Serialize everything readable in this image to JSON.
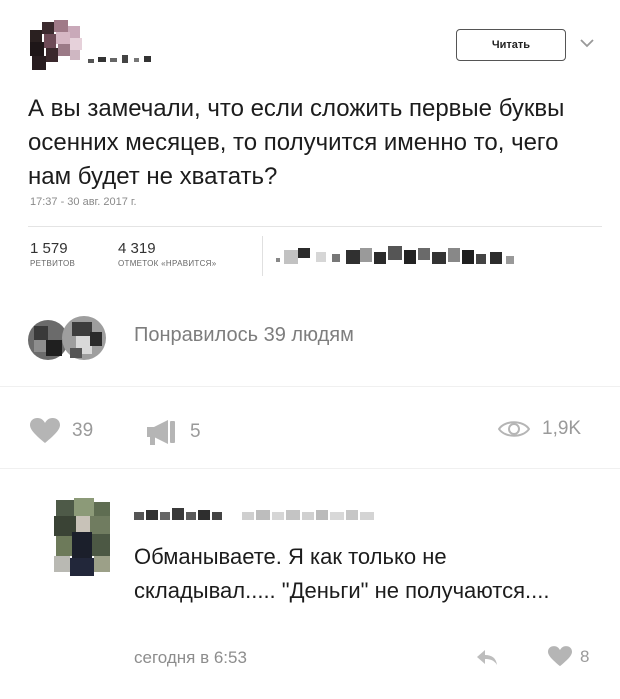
{
  "tweet": {
    "follow_label": "Читать",
    "text": "А вы замечали, что если сложить первые буквы осенних месяцев, то получится именно то, чего нам будет не хватать?",
    "timestamp": "17:37 - 30 авг. 2017 г.",
    "retweets": {
      "count": "1 579",
      "label": "РЕТВИТОВ"
    },
    "likes": {
      "count": "4 319",
      "label": "ОТМЕТОК «НРАВИТСЯ»"
    }
  },
  "post": {
    "liked_by_text": "Понравилось 39 людям",
    "like_count": "39",
    "share_count": "5",
    "views": "1,9K"
  },
  "comment": {
    "text": "Обманываете. Я как только не складывал..... \"Деньги\" не получаются....",
    "time": "сегодня в 6:53",
    "likes": "8"
  },
  "colors": {
    "text": "#1c1c1c",
    "muted": "#8d8d8d",
    "icon": "#b0b0b0"
  }
}
